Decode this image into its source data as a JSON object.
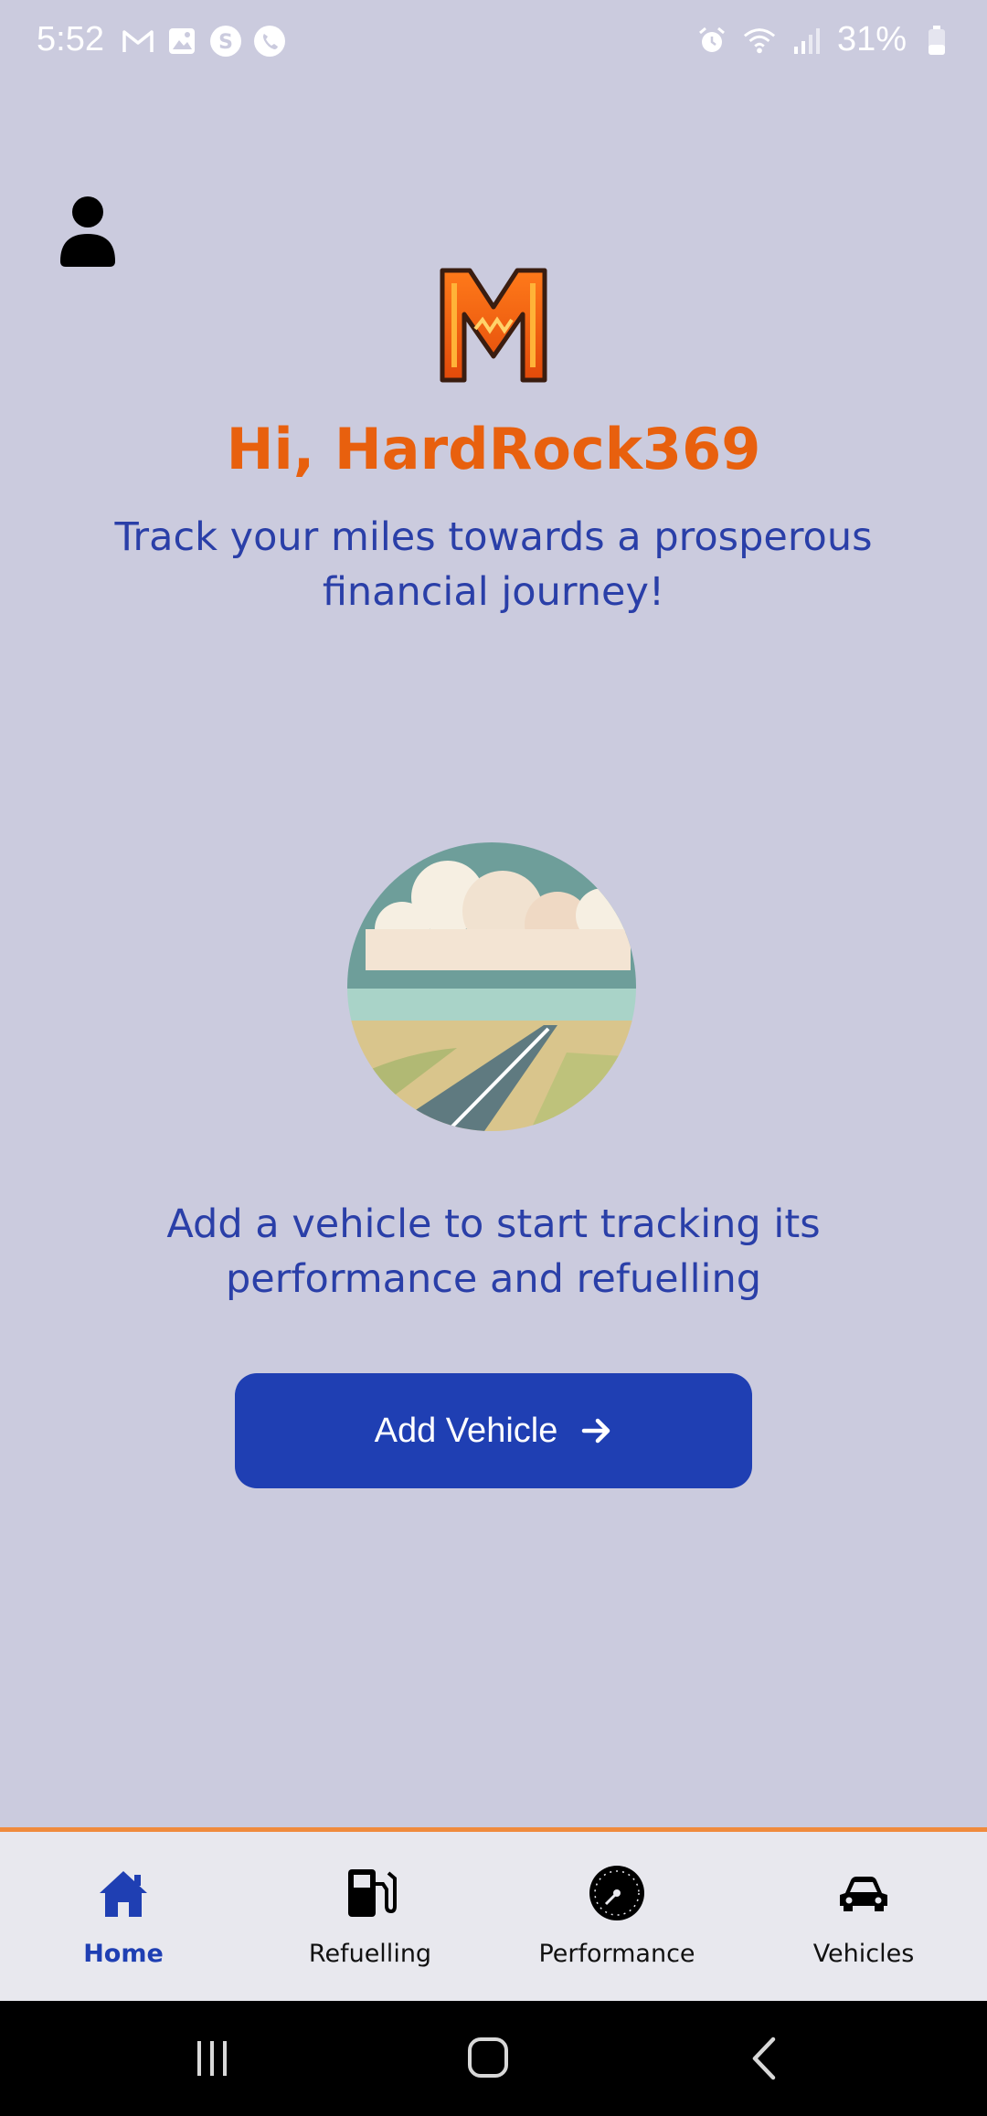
{
  "status_bar": {
    "time": "5:52",
    "battery_percent": "31%",
    "left_icons": [
      "gmail-icon",
      "gallery-icon",
      "app-s-icon",
      "phone-app-icon"
    ],
    "right_icons": [
      "alarm-icon",
      "wifi-icon",
      "signal-icon",
      "battery-icon"
    ]
  },
  "header": {
    "greeting": "Hi, HardRock369",
    "tagline": "Track your miles towards a prosperous financial journey!"
  },
  "main": {
    "empty_message": "Add a vehicle to start tracking its performance and refuelling",
    "add_button_label": "Add Vehicle"
  },
  "bottom_nav": {
    "items": [
      {
        "label": "Home",
        "icon": "home-icon",
        "active": true
      },
      {
        "label": "Refuelling",
        "icon": "fuel-pump-icon",
        "active": false
      },
      {
        "label": "Performance",
        "icon": "speedometer-icon",
        "active": false
      },
      {
        "label": "Vehicles",
        "icon": "car-icon",
        "active": false
      }
    ]
  },
  "colors": {
    "background": "#cbcbde",
    "greeting": "#e8600e",
    "text_blue": "#2a3fa8",
    "button": "#1f3fb3",
    "nav_border": "#f08a3c",
    "nav_background": "#e8e8ee"
  }
}
